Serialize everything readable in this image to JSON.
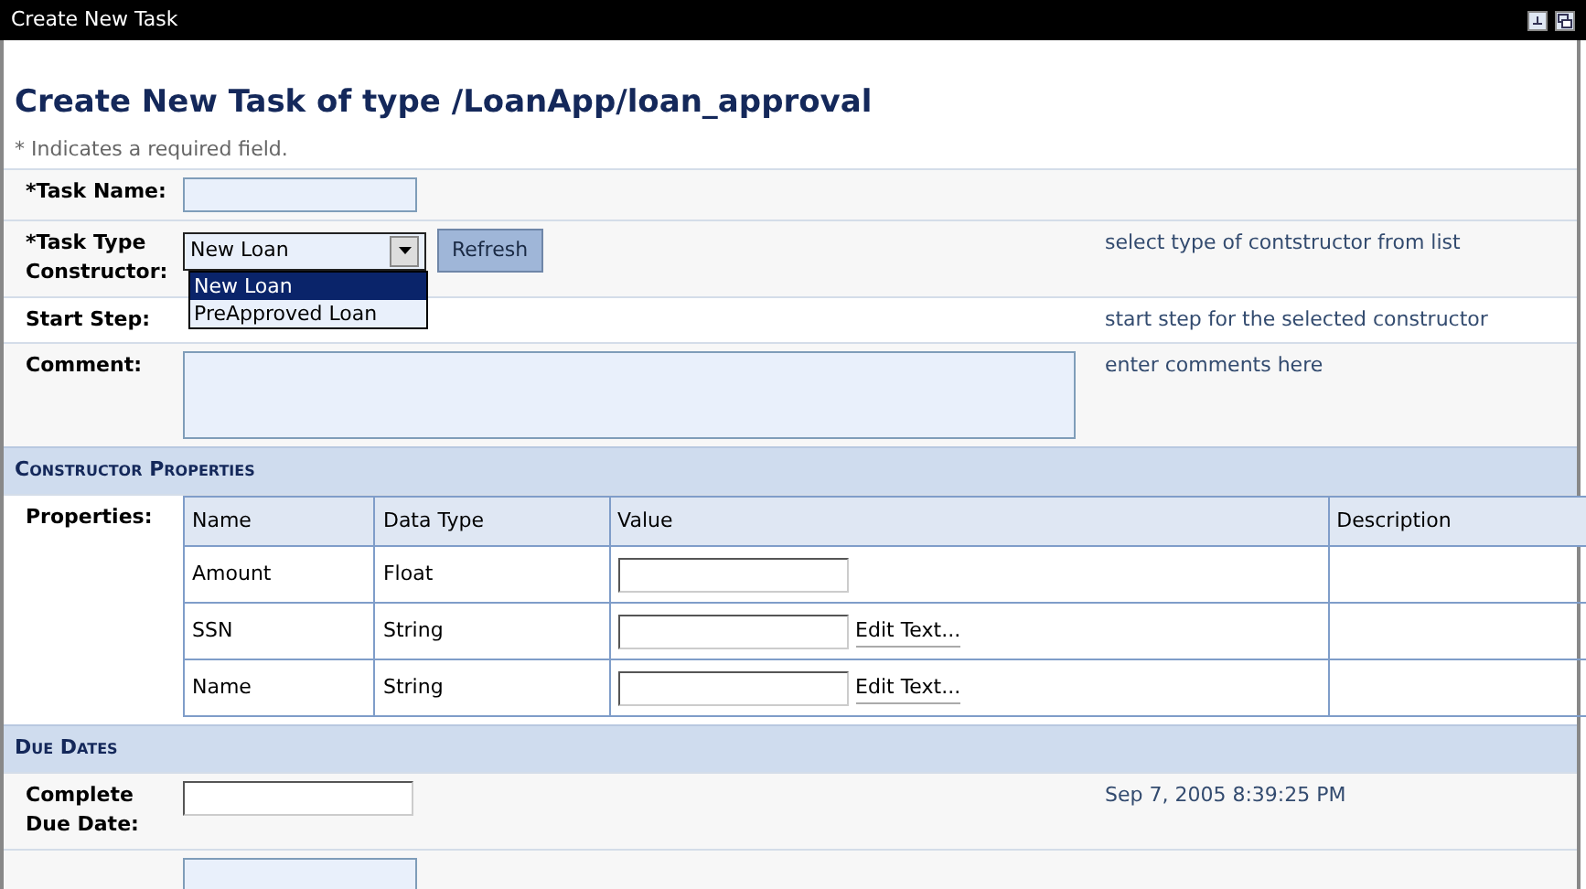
{
  "window": {
    "title": "Create New Task"
  },
  "heading": "Create New Task of type /LoanApp/loan_approval",
  "required_note": "* Indicates a required field.",
  "rows": [
    {
      "kind": "text",
      "label": "*Task Name:"
    },
    {
      "kind": "select",
      "label": "*Task Type Constructor:",
      "value": "New Loan",
      "expanded": true,
      "button": "Refresh",
      "hint": "select type of contstructor from list",
      "options": [
        {
          "label": "New Loan",
          "selected": true
        },
        {
          "label": "PreApproved Loan",
          "selected": false
        }
      ]
    },
    {
      "kind": "static",
      "label": "Start Step:",
      "hint": "start step for the selected constructor"
    },
    {
      "kind": "textarea",
      "label": "Comment:",
      "hint": "enter comments here"
    },
    {
      "kind": "section",
      "label": "Constructor Properties"
    },
    {
      "kind": "properties",
      "label": "Properties:",
      "columns": [
        "Name",
        "Data Type",
        "Value",
        "Description"
      ],
      "rows": [
        {
          "name": "Amount",
          "type": "Float"
        },
        {
          "name": "SSN",
          "type": "String",
          "action": "Edit Text..."
        },
        {
          "name": "Name",
          "type": "String",
          "action": "Edit Text..."
        }
      ]
    },
    {
      "kind": "section",
      "label": "Due Dates"
    },
    {
      "kind": "text",
      "label": "Complete Due Date:",
      "hint": "Sep 7, 2005 8:39:25 PM"
    },
    {
      "kind": "text"
    }
  ]
}
